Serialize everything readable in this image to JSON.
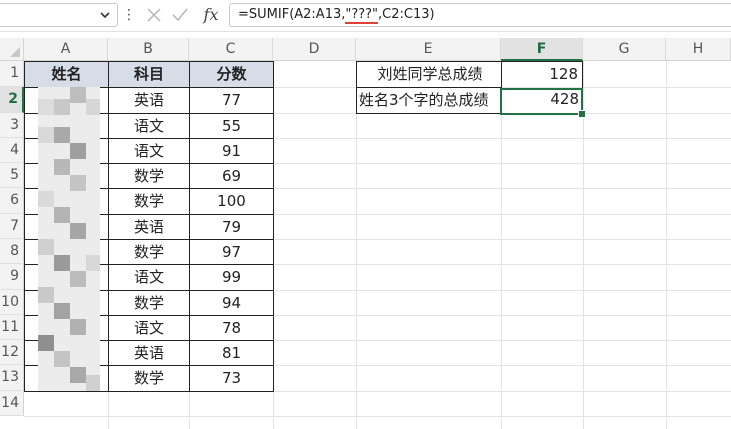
{
  "formula_bar": {
    "namebox_value": "",
    "more_glyph": "⋮",
    "fx_label": "fx",
    "formula_prefix": "=SUMIF(A2:A13,",
    "formula_criteria": "\"???\"",
    "formula_suffix": ",C2:C13)"
  },
  "columns": [
    "A",
    "B",
    "C",
    "D",
    "E",
    "F",
    "G",
    "H"
  ],
  "active_column": "F",
  "rows": [
    "1",
    "2",
    "3",
    "4",
    "5",
    "6",
    "7",
    "8",
    "9",
    "10",
    "11",
    "12",
    "13",
    "14"
  ],
  "active_row": "2",
  "table": {
    "headers": [
      "姓名",
      "科目",
      "分数"
    ],
    "records": [
      {
        "subject": "英语",
        "score": "77"
      },
      {
        "subject": "语文",
        "score": "55"
      },
      {
        "subject": "语文",
        "score": "91"
      },
      {
        "subject": "数学",
        "score": "69"
      },
      {
        "subject": "数学",
        "score": "100"
      },
      {
        "subject": "英语",
        "score": "79"
      },
      {
        "subject": "数学",
        "score": "97"
      },
      {
        "subject": "语文",
        "score": "99"
      },
      {
        "subject": "数学",
        "score": "94"
      },
      {
        "subject": "语文",
        "score": "78"
      },
      {
        "subject": "英语",
        "score": "81"
      },
      {
        "subject": "数学",
        "score": "73"
      }
    ]
  },
  "summary": [
    {
      "label": "刘姓同学总成绩",
      "value": "128"
    },
    {
      "label": "姓名3个字的总成绩",
      "value": "428"
    }
  ],
  "colors": {
    "header_fill": "#d6dde9",
    "accent": "#217346",
    "error_underline": "#e0403a"
  },
  "icons": {
    "namebox_dropdown": "chevron-down-icon",
    "cancel": "cross-icon",
    "enter": "checkmark-icon",
    "corner": "select-all-icon"
  }
}
